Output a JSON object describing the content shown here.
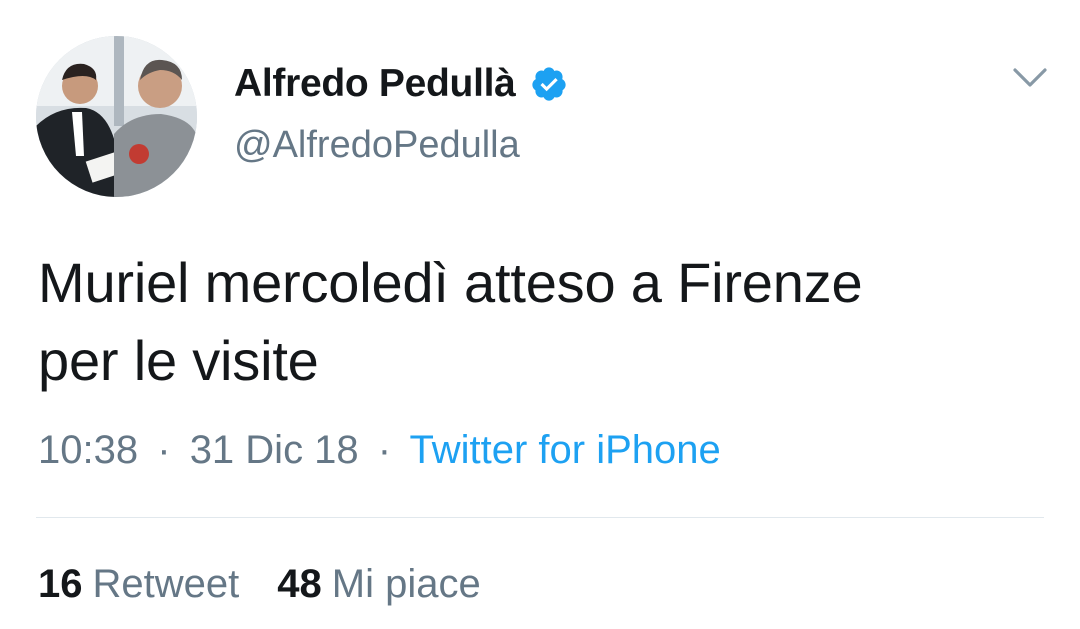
{
  "tweet": {
    "author": {
      "display_name": "Alfredo Pedullà",
      "handle": "@AlfredoPedulla",
      "verified": true,
      "avatar_icon": "profile-photo"
    },
    "text_line1": "Muriel mercoledì atteso a Firenze",
    "text_line2": "per le visite",
    "time": "10:38",
    "separator": "·",
    "date": "31 Dic 18",
    "source": "Twitter for iPhone",
    "retweets": {
      "count": "16",
      "label": "Retweet"
    },
    "likes": {
      "count": "48",
      "label": "Mi piace"
    }
  },
  "icons": {
    "verified": "verified-badge-icon",
    "menu": "chevron-down-icon"
  },
  "colors": {
    "text_primary": "#14171a",
    "text_secondary": "#657786",
    "link": "#1da1f2",
    "verified": "#1da1f2",
    "divider": "#e1e8ed"
  }
}
